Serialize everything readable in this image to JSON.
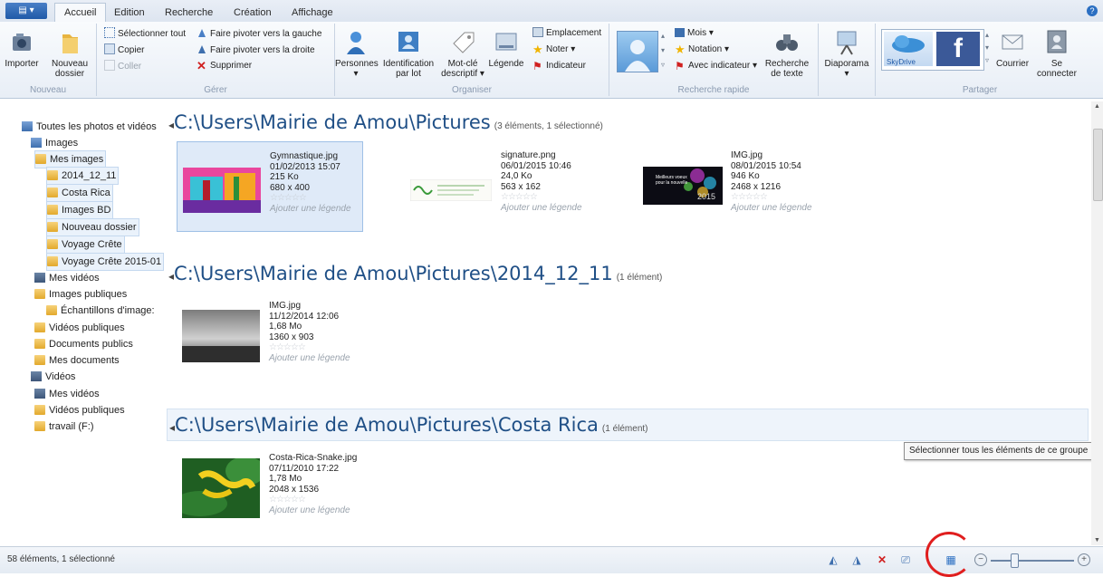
{
  "tabs": [
    "Accueil",
    "Edition",
    "Recherche",
    "Création",
    "Affichage"
  ],
  "ribbon": {
    "nouveau": {
      "caption": "Nouveau",
      "importer": "Importer",
      "nouveau_dossier_1": "Nouveau",
      "nouveau_dossier_2": "dossier"
    },
    "gerer": {
      "caption": "Gérer",
      "select_all": "Sélectionner tout",
      "copier": "Copier",
      "coller": "Coller",
      "rot_left": "Faire pivoter vers la gauche",
      "rot_right": "Faire pivoter vers la droite",
      "supprimer": "Supprimer"
    },
    "organiser": {
      "caption": "Organiser",
      "personnes": "Personnes",
      "ident_1": "Identification",
      "ident_2": "par lot",
      "motcle_1": "Mot-clé",
      "motcle_2": "descriptif",
      "legende": "Légende",
      "emplacement": "Emplacement",
      "noter": "Noter",
      "indicateur": "Indicateur"
    },
    "recherche": {
      "caption": "Recherche rapide",
      "mois": "Mois",
      "notation": "Notation",
      "avec_ind": "Avec indicateur",
      "rtexte_1": "Recherche",
      "rtexte_2": "de texte"
    },
    "diaporama": "Diaporama",
    "partager": {
      "caption": "Partager",
      "skydrive": "SkyDrive",
      "courrier": "Courrier",
      "connect_1": "Se",
      "connect_2": "connecter"
    }
  },
  "nav": {
    "items": [
      "Toutes les photos et vidéos",
      "Images",
      "Mes images",
      "2014_12_11",
      "Costa Rica",
      "Images BD",
      "Nouveau dossier",
      "Voyage Crête",
      "Voyage Crête 2015-01",
      "Mes vidéos",
      "Images publiques",
      "Échantillons d'image:",
      "Vidéos publiques",
      "Documents publics",
      "Mes documents",
      "Vidéos",
      "Mes vidéos",
      "Vidéos publiques",
      "travail (F:)"
    ]
  },
  "groups": [
    {
      "path": "C:\\Users\\Mairie de Amou\\Pictures",
      "count": "(3 éléments, 1 sélectionné)"
    },
    {
      "path": "C:\\Users\\Mairie de Amou\\Pictures\\2014_12_11",
      "count": "(1 élément)"
    },
    {
      "path": "C:\\Users\\Mairie de Amou\\Pictures\\Costa Rica",
      "count": "(1 élément)"
    }
  ],
  "photos": [
    {
      "name": "Gymnastique.jpg",
      "date": "01/02/2013 15:07",
      "size": "215 Ko",
      "dims": "680 x 400",
      "caption": "Ajouter une légende"
    },
    {
      "name": "signature.png",
      "date": "06/01/2015 10:46",
      "size": "24,0 Ko",
      "dims": "563 x 162",
      "caption": "Ajouter une légende"
    },
    {
      "name": "IMG.jpg",
      "date": "08/01/2015 10:54",
      "size": "946 Ko",
      "dims": "2468 x 1216",
      "caption": "Ajouter une légende",
      "thumb_text_1": "Meilleurs voeux",
      "thumb_text_2": "pour la nouvelle",
      "thumb_text_3": "2015"
    },
    {
      "name": "IMG.jpg",
      "date": "11/12/2014 12:06",
      "size": "1,68 Mo",
      "dims": "1360 x 903",
      "caption": "Ajouter une légende"
    },
    {
      "name": "Costa-Rica-Snake.jpg",
      "date": "07/11/2010 17:22",
      "size": "1,78 Mo",
      "dims": "2048 x 1536",
      "caption": "Ajouter une légende"
    }
  ],
  "stars": "☆☆☆☆☆",
  "tooltip": "Sélectionner tous les éléments de ce groupe",
  "status": {
    "text": "58 éléments, 1 sélectionné"
  }
}
